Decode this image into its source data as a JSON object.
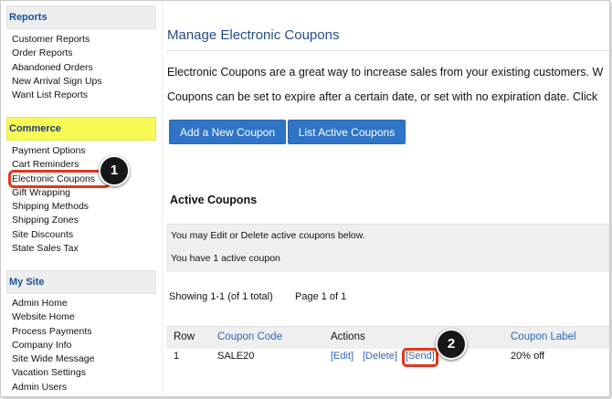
{
  "sidebar": {
    "reports": {
      "heading": "Reports",
      "items": [
        "Customer Reports",
        "Order Reports",
        "Abandoned Orders",
        "New Arrival Sign Ups",
        "Want List Reports"
      ]
    },
    "commerce": {
      "heading": "Commerce",
      "items": [
        "Payment Options",
        "Cart Reminders",
        "Electronic Coupons",
        "Gift Wrapping",
        "Shipping Methods",
        "Shipping Zones",
        "Site Discounts",
        "State Sales Tax"
      ]
    },
    "mysite": {
      "heading": "My Site",
      "items": [
        "Admin Home",
        "Website Home",
        "Process Payments",
        "Company Info",
        "Site Wide Message",
        "Vacation Settings",
        "Admin Users"
      ]
    }
  },
  "main": {
    "title": "Manage Electronic Coupons",
    "intro1": "Electronic Coupons are a great way to increase sales from your existing customers. W",
    "intro2": "Coupons can be set to expire after a certain date, or set with no expiration date. Click",
    "add_button": "Add a New Coupon",
    "list_button": "List Active Coupons",
    "active_title": "Active Coupons",
    "msg_edit": "You may Edit or Delete active coupons below.",
    "msg_count": "You have 1 active coupon",
    "showing": "Showing 1-1 (of 1 total)",
    "page": "Page 1 of 1",
    "table": {
      "headers": {
        "row": "Row",
        "code": "Coupon Code",
        "actions": "Actions",
        "label": "Coupon Label"
      },
      "rows": [
        {
          "row": "1",
          "code": "SALE20",
          "edit": "[Edit]",
          "delete": "[Delete]",
          "send": "[Send]",
          "label": "20% off"
        }
      ]
    }
  },
  "callouts": {
    "one": "1",
    "two": "2"
  },
  "colors": {
    "link": "#2f66b7",
    "button": "#2f74c7",
    "highlight": "#f8fa55",
    "callout": "#e0381a"
  }
}
